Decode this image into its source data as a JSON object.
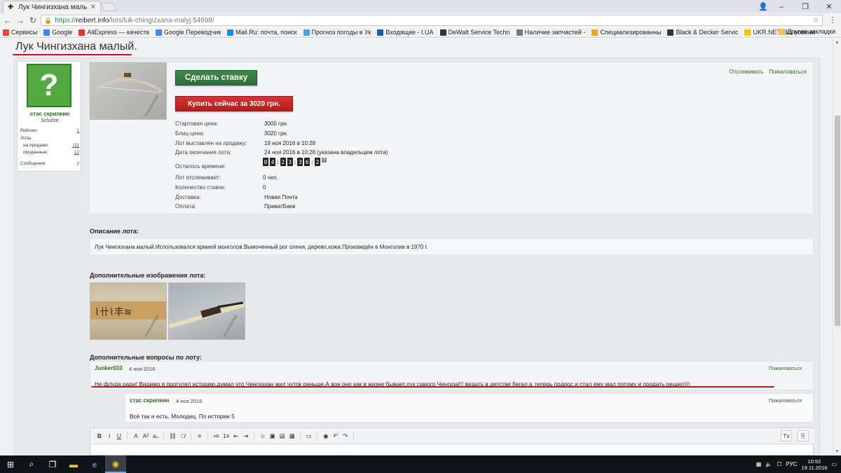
{
  "browser": {
    "tab_title": "Лук Чингизхана малый.",
    "url_https": "https://",
    "url_host": "reibert.info",
    "url_path": "/lots/luk-chingizxana-malyj.54698/",
    "bookmarks": [
      {
        "label": "Сервисы",
        "color": "#e8453c"
      },
      {
        "label": "Google",
        "color": "#4285f4"
      },
      {
        "label": "AliExpress — качеств",
        "color": "#e43225"
      },
      {
        "label": "Google Переводчик",
        "color": "#4285f4"
      },
      {
        "label": "Mail.Ru: почта, поиск",
        "color": "#168de2"
      },
      {
        "label": "Прогноз погоды в Ук",
        "color": "#3ea8e0"
      },
      {
        "label": "Входящие - I.UA",
        "color": "#1f5ca8"
      },
      {
        "label": "DeWalt Service Techn",
        "color": "#333333"
      },
      {
        "label": "Наличие запчастей -",
        "color": "#777777"
      },
      {
        "label": "Специализированны",
        "color": "#f0a81c"
      },
      {
        "label": "Black & Decker Servic",
        "color": "#333333"
      },
      {
        "label": "UKR.NET: Всі новини",
        "color": "#f6c300"
      }
    ],
    "bookmarks_other": "Другие закладки"
  },
  "lot": {
    "title": "Лук Чингизхана малый.",
    "bid_button": "Сделать ставку",
    "buy_button": "Купить сейчас за 3020 грн.",
    "watch_link": "Отслеживать",
    "report_link": "Пожаловаться",
    "info": [
      {
        "label": "Стартовая цена:",
        "value": "3000 грн."
      },
      {
        "label": "Блиц-цена:",
        "value": "3020 грн."
      },
      {
        "label": "Лот выставлен на продажу:",
        "value": "19 ноя 2016 в 10:28"
      },
      {
        "label": "Дата окончания лота:",
        "value": "24 ноя 2016 в 10:28 (указана владельцем лота)"
      }
    ],
    "time_left_label": "Осталось времени:",
    "timer": {
      "d1": "0",
      "d2": "4",
      "h1": "2",
      "h2": "3",
      "m1": "3",
      "m2": "6",
      "s1": "2",
      "sup": "9"
    },
    "info2": [
      {
        "label": "Лот отслеживает:",
        "value": "0 чел."
      },
      {
        "label": "Количество ставок:",
        "value": "0"
      },
      {
        "label": "Доставка:",
        "value": "Новая Почта"
      },
      {
        "label": "Оплата:",
        "value": "ПриватБанк"
      }
    ],
    "watermark": "armyandvintage"
  },
  "seller": {
    "name": "стас скрипкин",
    "rank": "Schütze",
    "rating_label": "Рейтинг:",
    "rating": "1",
    "lots_label": "Лоты",
    "selling_label": "на продаже:",
    "selling": "111",
    "sold_label": "проданные:",
    "sold": "12",
    "messages_label": "Сообщения:",
    "messages": "2"
  },
  "description": {
    "heading": "Описание лота:",
    "text": "Лук Чингизхана малый.Использовался армией монголов.Вымоченный рог оленя, дерево,кожа.Произведён в Монголии в 1970 г."
  },
  "images": {
    "heading": "Дополнительные изображения лота:"
  },
  "questions": {
    "heading": "Дополнительные вопросы по лоту:",
    "q_author": "Junker033",
    "q_date": "4 ноя 2016",
    "q_report": "Пожаловаться",
    "q_text": "Не флуда ради! Видимо я прогулял историю,думал что Чингизхан жил чуток раньше.А вон оно как в жизне бывает,лук самого Чингиза!!! видать в детстве бегал,а теперь подрос и стал ему мал потому и продать решил)))",
    "a_author": "стас скрипкин",
    "a_date": "4 ноя 2016",
    "a_report": "Пожаловаться",
    "a_text": "Всё так и есть. Молодец. По истории 5"
  },
  "editor": {
    "buttons": [
      "B",
      "I",
      "U",
      "A",
      "A²",
      "a₀",
      "⛓",
      "⛓̸",
      "≡",
      "•≡",
      "1≡",
      "⇤",
      "⇥",
      "☺",
      "▣",
      "▤",
      "▦",
      "▭",
      "◉",
      "↶",
      "↷"
    ],
    "right_buttons": [
      "Tx",
      "⎘"
    ]
  },
  "taskbar": {
    "lang": "РУС",
    "time": "10:52",
    "date": "19.11.2016"
  },
  "colors": {
    "accent_green": "#2a6d22",
    "buy_red": "#c62828",
    "bid_green": "#357a41",
    "annotation_red": "#d4141a"
  }
}
